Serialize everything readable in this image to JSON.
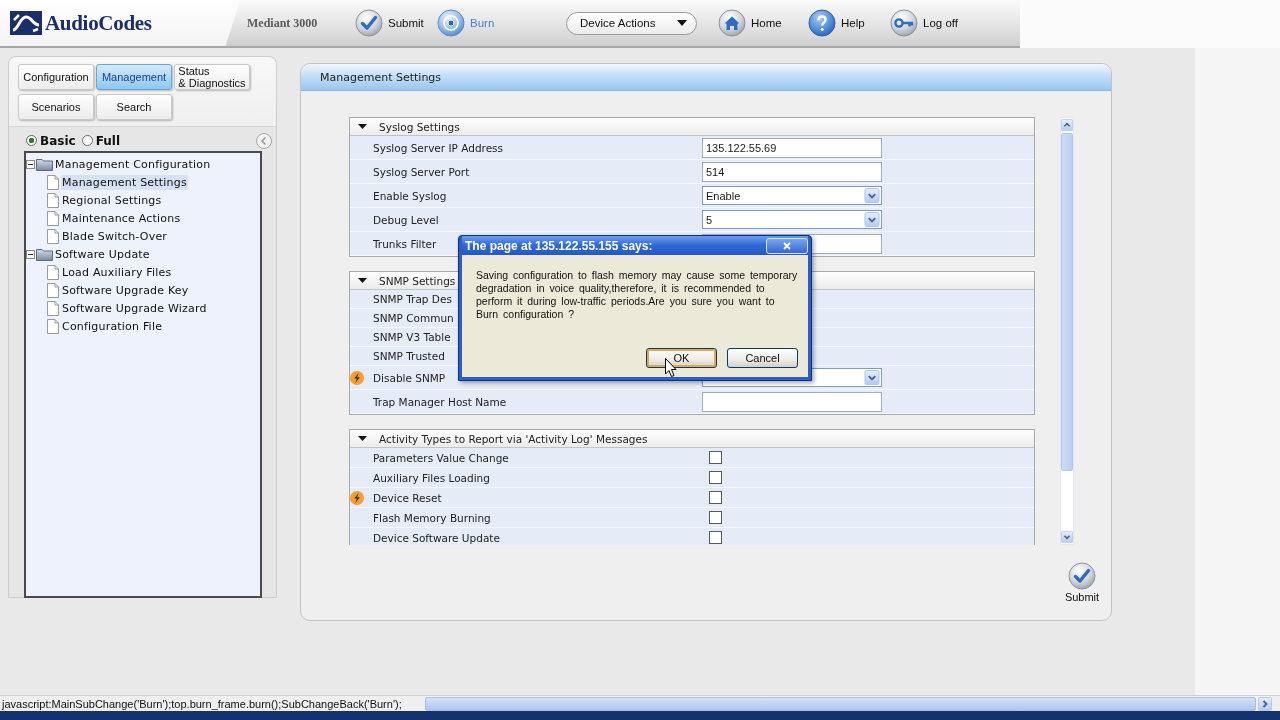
{
  "header": {
    "logo": "AudioCodes",
    "product": "Mediant 3000",
    "tools": [
      {
        "kind": "button",
        "label": "Submit",
        "highlighted": false
      },
      {
        "kind": "button",
        "label": "Burn",
        "highlighted": true
      },
      {
        "kind": "dropdown",
        "label": "Device Actions"
      },
      {
        "kind": "button",
        "label": "Home",
        "highlighted": false
      },
      {
        "kind": "button",
        "label": "Help",
        "highlighted": false
      },
      {
        "kind": "button",
        "label": "Log off",
        "highlighted": false
      }
    ]
  },
  "nav": {
    "tabs": [
      {
        "label": "Configuration",
        "selected": false
      },
      {
        "label": "Management",
        "selected": true
      },
      {
        "label": "Status\n& Diagnostics",
        "selected": false
      },
      {
        "label": "Scenarios",
        "selected": false
      },
      {
        "label": "Search",
        "selected": false
      }
    ],
    "view_modes": [
      {
        "label": "Basic",
        "selected": true
      },
      {
        "label": "Full",
        "selected": false
      }
    ],
    "tree": [
      {
        "label": "Management Configuration",
        "expanded": true,
        "selected": false,
        "children": [
          {
            "label": "Management Settings",
            "selected": true
          },
          {
            "label": "Regional Settings",
            "selected": false
          },
          {
            "label": "Maintenance Actions",
            "selected": false
          },
          {
            "label": "Blade Switch-Over",
            "selected": false
          }
        ]
      },
      {
        "label": "Software Update",
        "expanded": true,
        "selected": false,
        "children": [
          {
            "label": "Load Auxiliary Files",
            "selected": false
          },
          {
            "label": "Software Upgrade Key",
            "selected": false
          },
          {
            "label": "Software Upgrade Wizard",
            "selected": false
          },
          {
            "label": "Configuration File",
            "selected": false
          }
        ]
      }
    ]
  },
  "panel": {
    "title": "Management Settings",
    "sections": [
      {
        "title": "Syslog Settings",
        "expanded": true,
        "rows": [
          {
            "kind": "text",
            "label": "Syslog Server IP Address",
            "value": "135.122.55.69",
            "flagged": false
          },
          {
            "kind": "text",
            "label": "Syslog Server Port",
            "value": "514",
            "flagged": false
          },
          {
            "kind": "select",
            "label": "Enable Syslog",
            "value": "Enable",
            "flagged": false
          },
          {
            "kind": "select",
            "label": "Debug Level",
            "value": "5",
            "flagged": false
          },
          {
            "kind": "text",
            "label": "Trunks Filter",
            "flagged": false
          }
        ]
      },
      {
        "title": "SNMP Settings",
        "expanded": true,
        "rows": [
          {
            "kind": "label",
            "label": "SNMP Trap Des",
            "flagged": false
          },
          {
            "kind": "label",
            "label": "SNMP Commun",
            "flagged": false
          },
          {
            "kind": "label",
            "label": "SNMP V3 Table",
            "flagged": false
          },
          {
            "kind": "label",
            "label": "SNMP Trusted",
            "flagged": false
          },
          {
            "kind": "select",
            "label": "Disable SNMP",
            "flagged": true
          },
          {
            "kind": "text",
            "label": "Trap Manager Host Name",
            "flagged": false
          }
        ]
      },
      {
        "title": "Activity Types to Report via 'Activity Log' Messages",
        "expanded": true,
        "rows": [
          {
            "kind": "checkbox",
            "label": "Parameters Value Change",
            "checked": false,
            "flagged": false
          },
          {
            "kind": "checkbox",
            "label": "Auxiliary Files Loading",
            "checked": false,
            "flagged": false
          },
          {
            "kind": "checkbox",
            "label": "Device Reset",
            "checked": false,
            "flagged": true
          },
          {
            "kind": "checkbox",
            "label": "Flash Memory Burning",
            "checked": false,
            "flagged": false
          },
          {
            "kind": "checkbox",
            "label": "Device Software Update",
            "checked": false,
            "flagged": false
          }
        ]
      }
    ],
    "submit": "Submit"
  },
  "dialog": {
    "title": "The page at 135.122.55.155 says:",
    "message": "Saving configuration to flash memory may cause some temporary degradation in voice quality,therefore, it is recommended to perform it during low-traffic periods.Are you sure you want to Burn configuration ?",
    "buttons": [
      {
        "label": "OK",
        "focused": true
      },
      {
        "label": "Cancel",
        "focused": false
      }
    ]
  },
  "status_bar": {
    "text": "javascript:MainSubChange('Burn');top.burn_frame.burn();SubChangeBack('Burn');"
  }
}
